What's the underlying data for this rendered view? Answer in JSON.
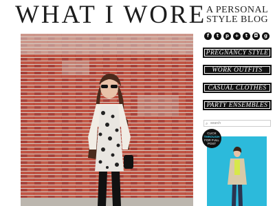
{
  "header": {
    "title": "WHAT I WORE",
    "tagline": "A PERSONAL STYLE BLOG"
  },
  "social": [
    "facebook-icon",
    "twitter-icon",
    "pinterest-icon",
    "bloglovin-icon",
    "tumblr-icon",
    "instagram-icon",
    "google-plus-icon"
  ],
  "nav": [
    {
      "label": "PREGNANCY STYLE"
    },
    {
      "label": "WORK OUTFITS"
    },
    {
      "label": "CASUAL CLOTHES"
    },
    {
      "label": "PARTY ENSEMBLES"
    }
  ],
  "search": {
    "placeholder": "search"
  },
  "badge": {
    "line1": "CLICK",
    "line2": "THROUGH",
    "line3": "FOR FULL",
    "line4": "POST"
  },
  "colors": {
    "accent": "#2bb8d8",
    "brick": "#b5483a",
    "nav_bg": "#111111"
  }
}
